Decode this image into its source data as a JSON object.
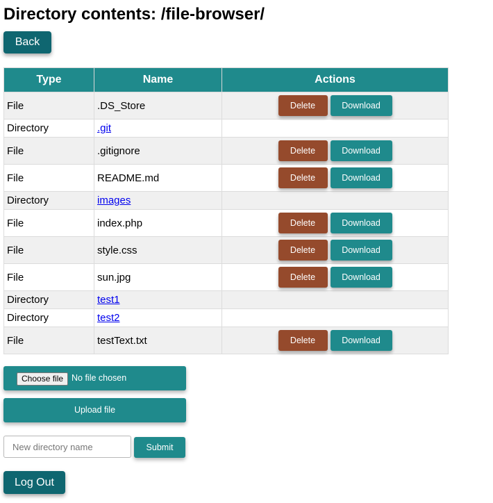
{
  "page_title": "Directory contents: /file-browser/",
  "back_label": "Back",
  "table": {
    "headers": [
      "Type",
      "Name",
      "Actions"
    ],
    "rows": [
      {
        "type": "File",
        "name": ".DS_Store",
        "is_dir": false
      },
      {
        "type": "Directory",
        "name": ".git",
        "is_dir": true
      },
      {
        "type": "File",
        "name": ".gitignore",
        "is_dir": false
      },
      {
        "type": "File",
        "name": "README.md",
        "is_dir": false
      },
      {
        "type": "Directory",
        "name": "images",
        "is_dir": true
      },
      {
        "type": "File",
        "name": "index.php",
        "is_dir": false
      },
      {
        "type": "File",
        "name": "style.css",
        "is_dir": false
      },
      {
        "type": "File",
        "name": "sun.jpg",
        "is_dir": false
      },
      {
        "type": "Directory",
        "name": "test1",
        "is_dir": true
      },
      {
        "type": "Directory",
        "name": "test2",
        "is_dir": true
      },
      {
        "type": "File",
        "name": "testText.txt",
        "is_dir": false
      }
    ],
    "delete_label": "Delete",
    "download_label": "Download"
  },
  "upload": {
    "choose_label": "Choose file",
    "no_file_text": "No file chosen",
    "upload_label": "Upload file"
  },
  "new_dir": {
    "placeholder": "New directory name",
    "value": "",
    "submit_label": "Submit"
  },
  "logout_label": "Log Out",
  "colors": {
    "header_teal": "#1f8a8c",
    "dark_teal": "#0f6670",
    "delete_brown": "#954a2c",
    "row_stripe": "#f0f0f0"
  }
}
